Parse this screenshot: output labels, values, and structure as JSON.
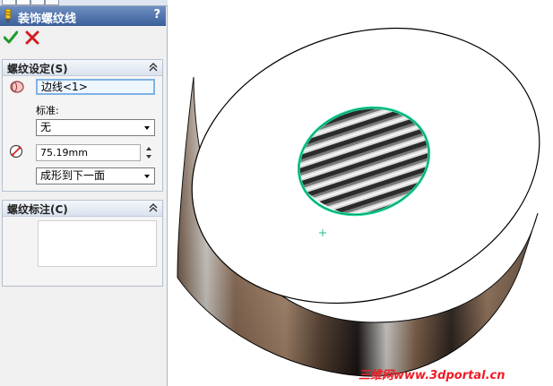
{
  "feature": {
    "title": "装饰螺纹线",
    "help": "?"
  },
  "thread_settings": {
    "header": "螺纹设定(S)",
    "edge_selection": "边线<1>",
    "standard_label": "标准:",
    "standard_value": "无",
    "diameter": "75.19mm",
    "end_condition": "成形到下一面"
  },
  "thread_callout": {
    "header": "螺纹标注(C)",
    "text": ""
  },
  "watermark": "三维网www.3dportal.cn",
  "colors": {
    "panel_title": "#3b5f9c",
    "ok_green": "#1e9a28",
    "cancel_red": "#d01f1f",
    "edge_highlight": "#22e2a0",
    "watermark_red": "#ee1c25"
  }
}
